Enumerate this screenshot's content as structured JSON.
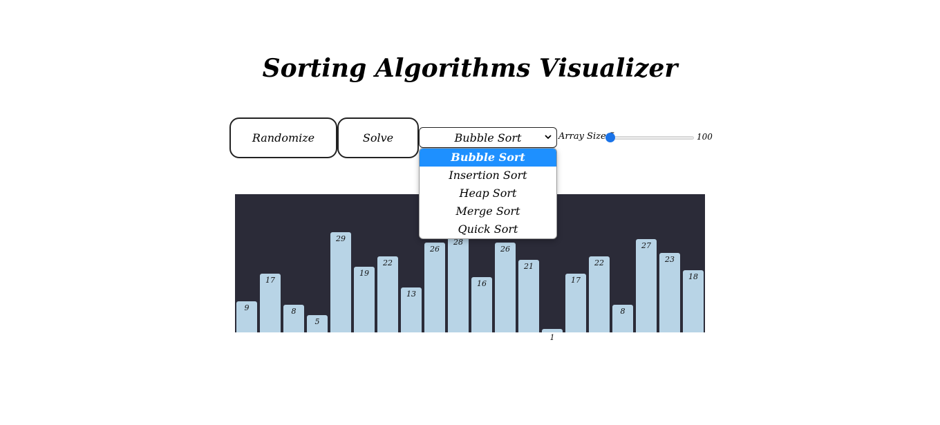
{
  "page": {
    "title": "Sorting Algorithms Visualizer"
  },
  "controls": {
    "randomize_label": "Randomize",
    "solve_label": "Solve",
    "algorithm_select": {
      "selected": "Bubble Sort",
      "options": [
        "Bubble Sort",
        "Insertion Sort",
        "Heap Sort",
        "Merge Sort",
        "Quick Sort"
      ],
      "open": true
    },
    "array_size": {
      "label": "Array Size:",
      "min": "5",
      "max": "100",
      "value": 5
    }
  },
  "colors": {
    "chart_background": "#2b2b38",
    "bar": "#b8d4e6",
    "accent": "#1a73e8",
    "option_highlight": "#1e90ff"
  },
  "chart_data": {
    "type": "bar",
    "values": [
      9,
      17,
      8,
      5,
      29,
      19,
      22,
      13,
      26,
      28,
      16,
      26,
      21,
      1,
      17,
      22,
      8,
      27,
      23,
      18
    ],
    "value_labels": [
      "9",
      "17",
      "8",
      "5",
      "29",
      "19",
      "22",
      "13",
      "26",
      "28",
      "16",
      "26",
      "21",
      "1",
      "17",
      "22",
      "8",
      "27",
      "23",
      "18"
    ],
    "ylim": [
      0,
      40
    ]
  }
}
